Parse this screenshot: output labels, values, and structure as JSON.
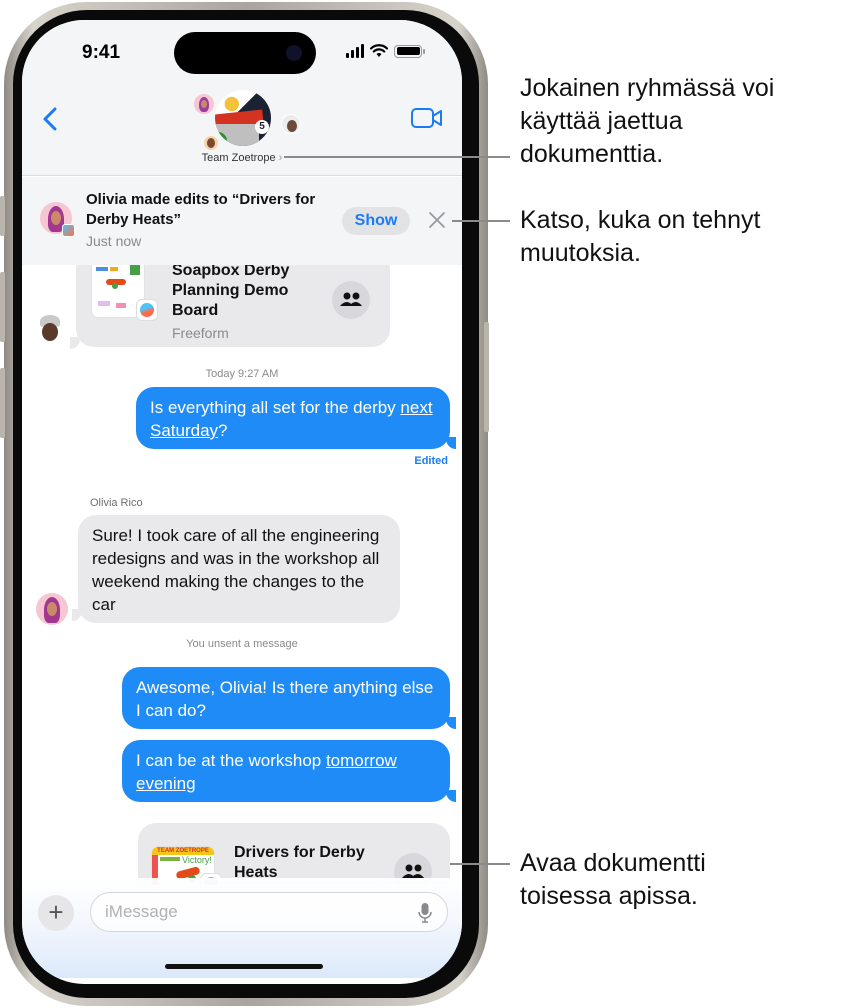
{
  "status_bar": {
    "time": "9:41"
  },
  "header": {
    "group_name": "Team Zoetrope",
    "back_icon": "chevron-left-icon",
    "video_icon": "video-camera-icon",
    "badge_number": "5"
  },
  "notification": {
    "title": "Olivia made edits to “Drivers for Derby Heats”",
    "time": "Just now",
    "show_label": "Show",
    "close_icon": "close-icon"
  },
  "messages": {
    "shared_board": {
      "title": "Soapbox Derby Planning Demo Board",
      "app": "Freeform"
    },
    "timestamp": "Today 9:27 AM",
    "outgoing_1": {
      "text_before": "Is everything all set for the derby ",
      "link": "next Saturday",
      "text_after": "?",
      "status": "Edited"
    },
    "incoming_sender": "Olivia Rico",
    "incoming_1": "Sure! I took care of all the engineering redesigns and was in the workshop all weekend making the changes to the car",
    "unsent_notice": "You unsent a message",
    "outgoing_2": "Awesome, Olivia! Is there anything else I can do?",
    "outgoing_3": {
      "text_before": "I can be at the workshop ",
      "link": "tomorrow evening"
    },
    "shared_doc": {
      "title": "Drivers for Derby Heats",
      "thumb_header": "TEAM ZOETROPE",
      "thumb_note": "Victory!"
    }
  },
  "compose": {
    "placeholder": "iMessage",
    "plus_label": "+"
  },
  "callouts": [
    {
      "text": "Jokainen ryhmässä voi käyttää jaettua dokumenttia."
    },
    {
      "text": "Katso, kuka on tehnyt muutoksia."
    },
    {
      "text": "Avaa dokumentti toisessa apissa."
    }
  ],
  "colors": {
    "accent": "#1a7cf5",
    "bubble_out": "#1f8bf7",
    "bubble_in": "#e9e9eb"
  }
}
